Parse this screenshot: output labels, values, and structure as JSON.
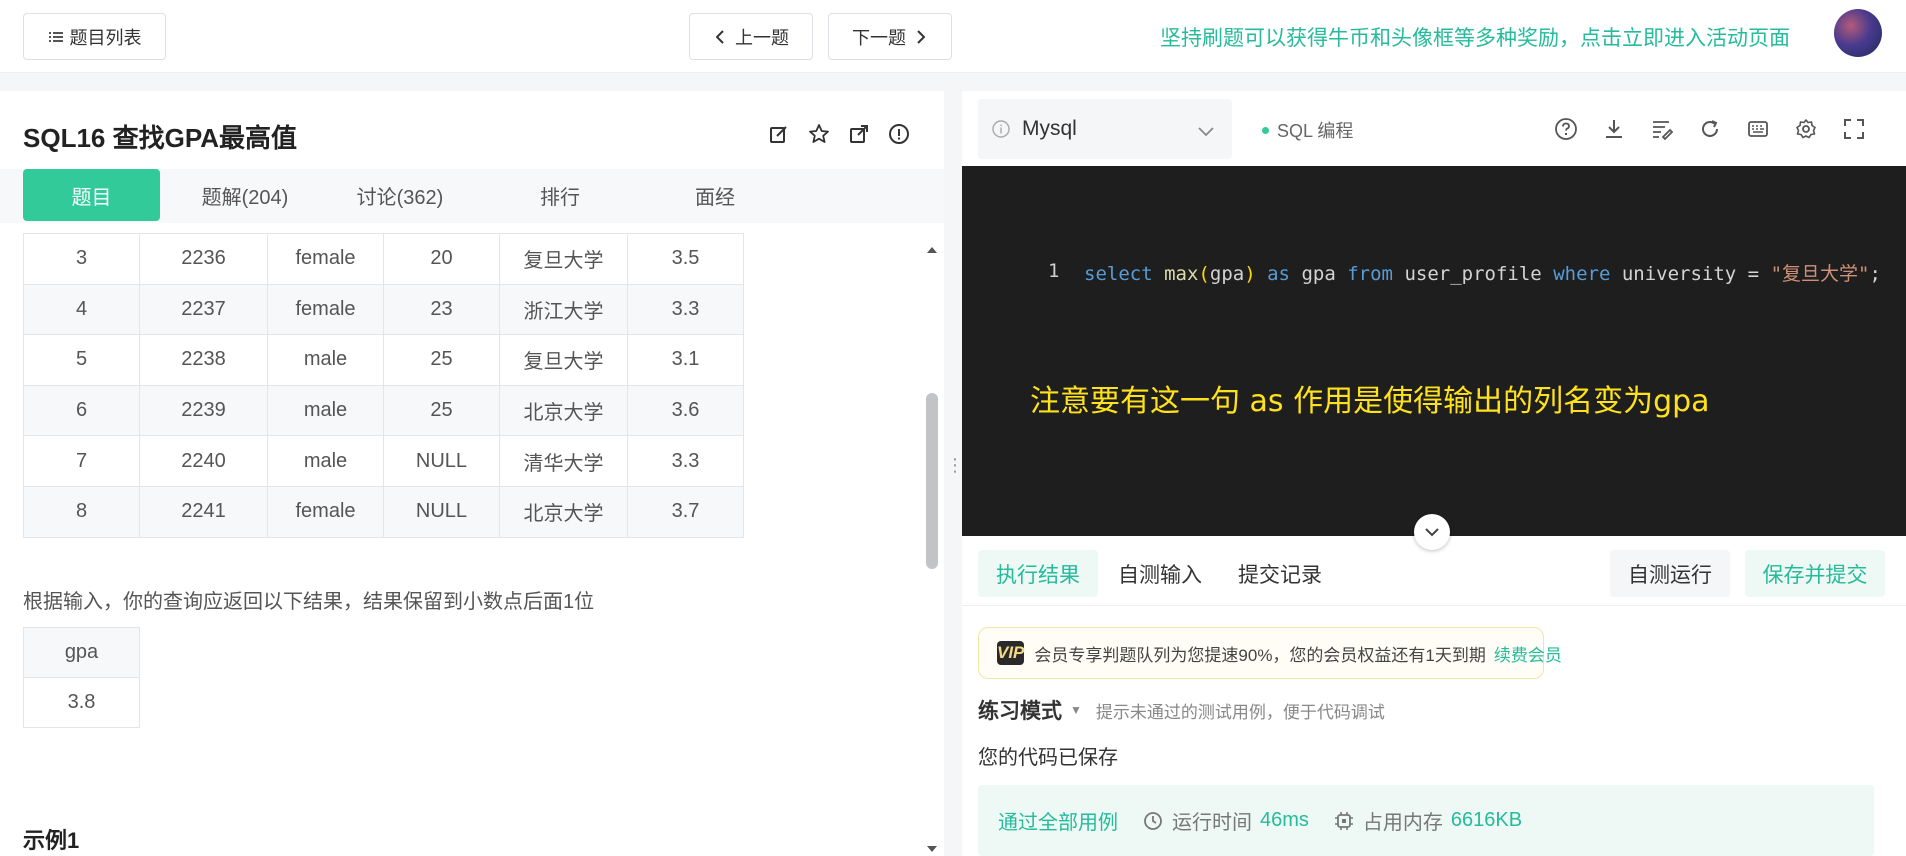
{
  "header": {
    "problem_list_label": "题目列表",
    "prev_label": "上一题",
    "next_label": "下一题",
    "promo_text": "坚持刷题可以获得牛币和头像框等多种奖励，点击立即进入活动页面"
  },
  "problem": {
    "title": "SQL16  查找GPA最高值",
    "tabs": [
      "题目",
      "题解(204)",
      "讨论(362)",
      "排行",
      "面经"
    ],
    "table_rows": [
      [
        "3",
        "2236",
        "female",
        "20",
        "复旦大学",
        "3.5"
      ],
      [
        "4",
        "2237",
        "female",
        "23",
        "浙江大学",
        "3.3"
      ],
      [
        "5",
        "2238",
        "male",
        "25",
        "复旦大学",
        "3.1"
      ],
      [
        "6",
        "2239",
        "male",
        "25",
        "北京大学",
        "3.6"
      ],
      [
        "7",
        "2240",
        "male",
        "NULL",
        "清华大学",
        "3.3"
      ],
      [
        "8",
        "2241",
        "female",
        "NULL",
        "北京大学",
        "3.7"
      ]
    ],
    "result_description": "根据输入，你的查询应返回以下结果，结果保留到小数点后面1位",
    "result_header": "gpa",
    "result_value": "3.8",
    "example_heading": "示例1"
  },
  "editor": {
    "language": "Mysql",
    "mode_label": "SQL 编程",
    "line_number": "1",
    "code_tokens": {
      "select": "select",
      "max": "max",
      "open": "(",
      "arg": "gpa",
      "close": ")",
      "as": "as",
      "alias": "gpa",
      "from": "from",
      "table": "user_profile",
      "where": "where",
      "cond": "university =",
      "string": "\"复旦大学\"",
      "end": ";"
    },
    "annotation": "注意要有这一句 as 作用是使得输出的列名变为gpa"
  },
  "console": {
    "tabs": [
      "执行结果",
      "自测输入",
      "提交记录"
    ],
    "run_label": "自测运行",
    "submit_label": "保存并提交",
    "vip_badge": "VIP",
    "vip_text": "会员专享判题队列为您提速90%，您的会员权益还有1天到期",
    "vip_link": "续费会员",
    "practice_mode": "练习模式",
    "practice_hint": "提示未通过的测试用例，便于代码调试",
    "saved_message": "您的代码已保存",
    "pass_text": "通过全部用例",
    "runtime_label": "运行时间",
    "runtime_value": "46ms",
    "memory_label": "占用内存",
    "memory_value": "6616KB"
  },
  "colors": {
    "accent": "#32ca99",
    "accent_text": "#25bb9b",
    "editor_bg": "#1e1e1e",
    "annotation": "#ffe21a"
  }
}
